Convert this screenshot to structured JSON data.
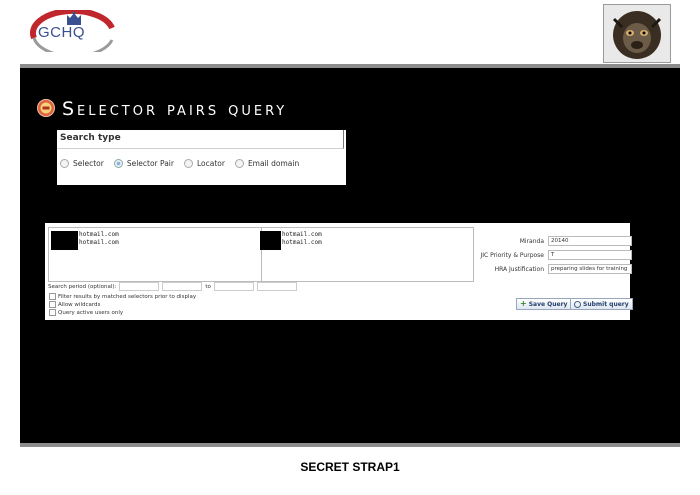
{
  "header": {
    "logo_text": "GCHQ",
    "classification": "SECRET STRAP1"
  },
  "page": {
    "title": "Selector pairs query"
  },
  "search_type": {
    "heading": "Search type",
    "options": [
      "Selector",
      "Selector Pair",
      "Locator",
      "Email domain"
    ],
    "selected": "Selector Pair"
  },
  "selectors": {
    "left": [
      "hotmail.com",
      "hotmail.com"
    ],
    "right": [
      "hotmail.com",
      "hotmail.com"
    ]
  },
  "fields": {
    "miranda_label": "Miranda",
    "miranda_value": "20140",
    "jic_label": "JIC Priority & Purpose",
    "jic_value": "T",
    "hra_label": "HRA Justification",
    "hra_value": "preparing slides for training"
  },
  "search_period": {
    "label": "Search period (optional):",
    "to_label": "to"
  },
  "checkboxes": [
    "Filter results by matched selectors prior to display",
    "Allow wildcards",
    "Query active users only"
  ],
  "buttons": {
    "save": "Save Query",
    "submit": "Submit query"
  },
  "colors": {
    "slide_background": "#000000",
    "frame_bar": "#8c8c8c",
    "logo_blue": "#3a4f8f",
    "logo_red": "#c0272d"
  }
}
